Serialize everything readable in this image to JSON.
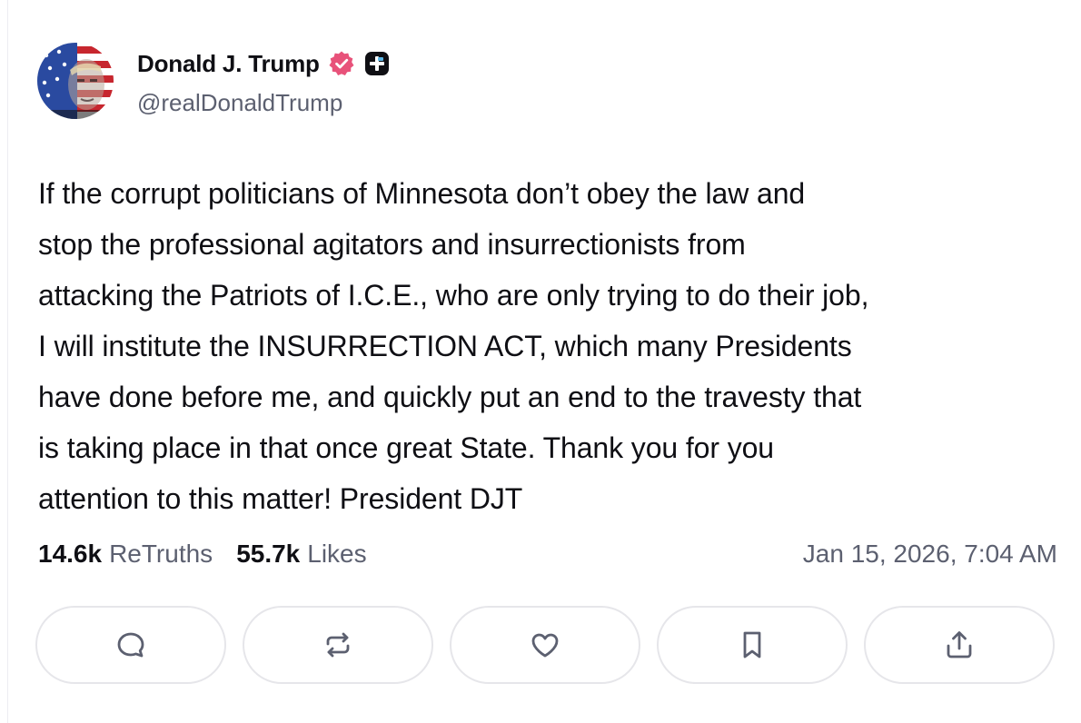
{
  "post": {
    "author": {
      "display_name": "Donald J. Trump",
      "handle": "@realDonaldTrump",
      "verified_badge_icon": "verified-badge-icon",
      "plus_badge_icon": "plus-badge-icon",
      "verified_color": "#e8527a"
    },
    "body": "If the corrupt politicians of Minnesota don’t obey the law and\nstop the professional agitators and insurrectionists from\nattacking the Patriots of I.C.E., who are only trying to do their job,\nI will institute the INSURRECTION ACT, which many Presidents\nhave done before me, and quickly put an end to the travesty that\nis taking place in that once great State. Thank you for you\nattention to this matter! President DJT",
    "stats": {
      "retruths_count": "14.6k",
      "retruths_label": "ReTruths",
      "likes_count": "55.7k",
      "likes_label": "Likes"
    },
    "timestamp": "Jan 15, 2026, 7:04 AM",
    "actions": [
      {
        "icon": "reply-icon"
      },
      {
        "icon": "retruth-icon"
      },
      {
        "icon": "like-icon"
      },
      {
        "icon": "bookmark-icon"
      },
      {
        "icon": "share-icon"
      }
    ]
  }
}
